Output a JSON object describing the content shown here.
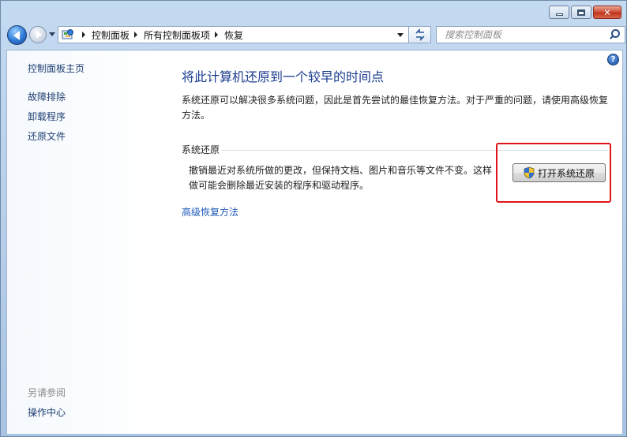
{
  "window": {
    "minimize_icon": "minimize-icon",
    "maximize_icon": "maximize-icon",
    "close_icon": "close-icon",
    "close_glyph": "✕"
  },
  "nav": {
    "back_icon": "back-arrow-icon",
    "forward_icon": "forward-arrow-icon",
    "breadcrumb": [
      "控制面板",
      "所有控制面板项",
      "恢复"
    ],
    "search_placeholder": "搜索控制面板"
  },
  "sidebar": {
    "home": "控制面板主页",
    "links": [
      "故障排除",
      "卸载程序",
      "还原文件"
    ],
    "see_also": "另请参阅",
    "action_center": "操作中心"
  },
  "main": {
    "help_glyph": "?",
    "title": "将此计算机还原到一个较早的时间点",
    "intro": "系统还原可以解决很多系统问题，因此是首先尝试的最佳恢复方法。对于严重的问题，请使用高级恢复方法。",
    "section_title": "系统还原",
    "section_desc": "撤销最近对系统所做的更改，但保持文档、图片和音乐等文件不变。这样做可能会删除最近安装的程序和驱动程序。",
    "open_button": "打开系统还原",
    "advanced_link": "高级恢复方法"
  },
  "colors": {
    "title_blue": "#1a3d8f",
    "link_blue": "#1c58b8",
    "highlight_red": "#e0151b"
  }
}
